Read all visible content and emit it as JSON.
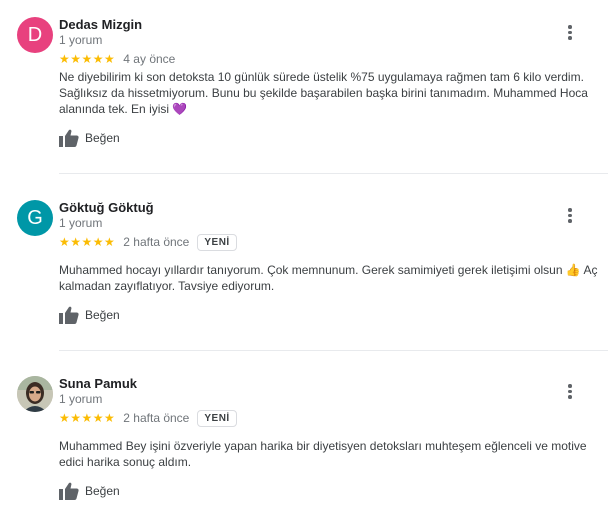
{
  "reviews": [
    {
      "avatar_letter": "D",
      "avatar_color": "#e8417e",
      "name": "Dedas Mizgin",
      "count": "1 yorum",
      "stars": "★★★★★",
      "time": "4 ay önce",
      "badge": "",
      "text_main": "Ne diyebilirim ki son detoksta 10 günlük sürede üstelik %75 uygulamaya rağmen tam 6 kilo verdim. Sağlıksız da hissetmiyorum. Bunu bu şekilde başarabilen başka birini tanımadım. Muhammed Hoca alanında tek. En iyisi",
      "text_emoji": "💜",
      "text_tail": "",
      "like_label": "Beğen"
    },
    {
      "avatar_letter": "G",
      "avatar_color": "#0097a7",
      "name": "Göktuğ Göktuğ",
      "count": "1 yorum",
      "stars": "★★★★★",
      "time": "2 hafta önce",
      "badge": "YENİ",
      "text_main": "Muhammed hocayı yıllardır tanıyorum. Çok memnunum. Gerek samimiyeti gerek iletişimi olsun",
      "text_emoji": "👍",
      "text_tail": "Aç kalmadan zayıflatıyor. Tavsiye ediyorum.",
      "like_label": "Beğen"
    },
    {
      "avatar_letter": "",
      "avatar_color": "#c9c3b5",
      "name": "Suna Pamuk",
      "count": "1 yorum",
      "stars": "★★★★★",
      "time": "2 hafta önce",
      "badge": "YENİ",
      "text_main": "Muhammed Bey işini özveriyle yapan harika bir diyetisyen detoksları muhteşem eğlenceli ve motive edici harika sonuç aldım.",
      "text_emoji": "",
      "text_tail": "",
      "like_label": "Beğen"
    }
  ]
}
